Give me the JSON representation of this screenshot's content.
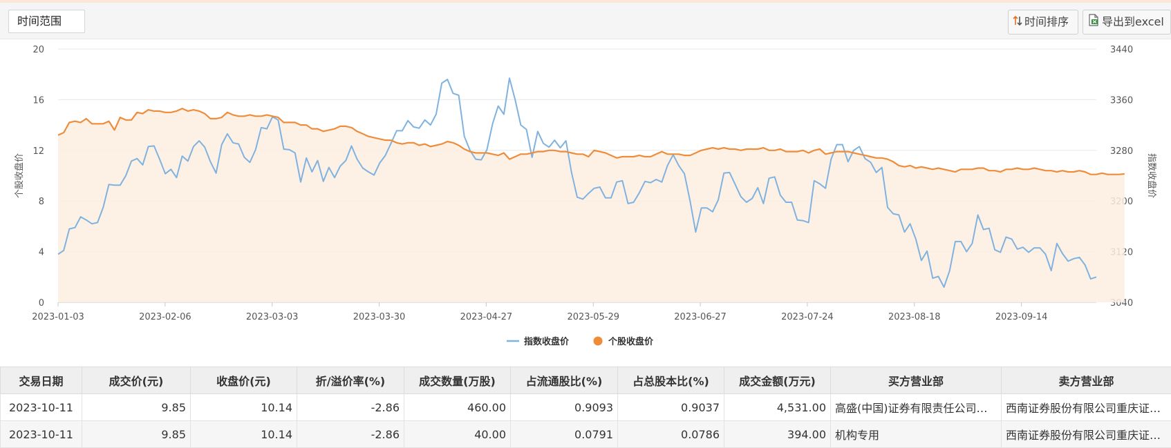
{
  "toolbar": {
    "range_label": "时间范围",
    "sort_label": "时间排序",
    "export_label": "导出到excel"
  },
  "chart_data": {
    "type": "line",
    "xlabel": "",
    "ylabel": "个股收盘价",
    "y2label": "指数收盘价",
    "ylim": [
      0,
      20
    ],
    "y2lim": [
      3040,
      3440
    ],
    "yticks": [
      "0",
      "4",
      "8",
      "12",
      "16",
      "20"
    ],
    "y2ticks": [
      "3040",
      "3120",
      "3200",
      "3280",
      "3360",
      "3440"
    ],
    "xticks": [
      "2023-01-03",
      "2023-02-06",
      "2023-03-03",
      "2023-03-30",
      "2023-04-27",
      "2023-05-29",
      "2023-06-27",
      "2023-07-24",
      "2023-08-18",
      "2023-09-14"
    ],
    "legend_position": "bottom",
    "grid": true,
    "series": [
      {
        "name": "指数收盘价",
        "axis": "right",
        "color": "#7fb2df",
        "values": [
          3116,
          3122,
          3156,
          3158,
          3175,
          3170,
          3164,
          3166,
          3190,
          3226,
          3225,
          3225,
          3240,
          3263,
          3267,
          3257,
          3286,
          3287,
          3266,
          3243,
          3250,
          3237,
          3271,
          3263,
          3286,
          3295,
          3285,
          3262,
          3244,
          3289,
          3306,
          3292,
          3290,
          3269,
          3261,
          3281,
          3316,
          3314,
          3333,
          3328,
          3282,
          3281,
          3276,
          3230,
          3268,
          3246,
          3264,
          3231,
          3253,
          3237,
          3255,
          3264,
          3287,
          3266,
          3252,
          3246,
          3241,
          3260,
          3272,
          3291,
          3311,
          3311,
          3327,
          3317,
          3315,
          3328,
          3320,
          3337,
          3386,
          3392,
          3370,
          3367,
          3302,
          3280,
          3266,
          3265,
          3281,
          3322,
          3350,
          3337,
          3394,
          3360,
          3320,
          3313,
          3269,
          3310,
          3291,
          3285,
          3296,
          3284,
          3295,
          3245,
          3206,
          3203,
          3212,
          3220,
          3222,
          3205,
          3205,
          3230,
          3232,
          3196,
          3198,
          3213,
          3231,
          3229,
          3234,
          3230,
          3256,
          3273,
          3256,
          3243,
          3200,
          3151,
          3189,
          3189,
          3183,
          3202,
          3244,
          3245,
          3226,
          3207,
          3198,
          3204,
          3221,
          3196,
          3236,
          3238,
          3209,
          3198,
          3198,
          3170,
          3169,
          3166,
          3232,
          3227,
          3220,
          3266,
          3289,
          3289,
          3262,
          3280,
          3286,
          3267,
          3261,
          3245,
          3253,
          3190,
          3180,
          3178,
          3151,
          3164,
          3140,
          3106,
          3121,
          3078,
          3081,
          3064,
          3090,
          3136,
          3136,
          3120,
          3133,
          3178,
          3155,
          3157,
          3123,
          3119,
          3143,
          3140,
          3124,
          3127,
          3119,
          3126,
          3126,
          3116,
          3090,
          3133,
          3117,
          3105,
          3109,
          3111,
          3099,
          3077,
          3080
        ]
      },
      {
        "name": "个股收盘价",
        "axis": "left",
        "color": "#ef8c3a",
        "values": [
          13.2,
          13.4,
          14.2,
          14.3,
          14.2,
          14.5,
          14.1,
          14.1,
          14.1,
          14.3,
          13.6,
          14.6,
          14.4,
          14.4,
          15.0,
          14.9,
          15.2,
          15.1,
          15.1,
          15.0,
          15.0,
          15.1,
          15.3,
          15.1,
          15.2,
          15.1,
          14.9,
          14.5,
          14.5,
          14.6,
          15.0,
          14.8,
          14.7,
          14.7,
          14.8,
          14.7,
          14.7,
          14.8,
          14.7,
          14.6,
          14.2,
          14.2,
          14.2,
          14.0,
          14.0,
          13.7,
          13.7,
          13.5,
          13.6,
          13.7,
          13.9,
          13.9,
          13.8,
          13.5,
          13.3,
          13.1,
          13.0,
          12.9,
          12.8,
          12.8,
          12.6,
          12.5,
          12.6,
          12.6,
          12.4,
          12.5,
          12.3,
          12.4,
          12.5,
          12.7,
          12.6,
          12.4,
          12.1,
          11.9,
          11.8,
          11.8,
          11.8,
          11.7,
          11.6,
          11.8,
          11.3,
          11.5,
          11.7,
          11.7,
          11.8,
          11.9,
          11.9,
          12.0,
          12.0,
          11.9,
          11.9,
          11.8,
          11.7,
          11.7,
          11.5,
          12.0,
          11.9,
          11.8,
          11.6,
          11.4,
          11.5,
          11.5,
          11.5,
          11.6,
          11.5,
          11.5,
          11.7,
          11.9,
          11.7,
          11.7,
          11.7,
          11.6,
          11.6,
          11.8,
          12.0,
          12.1,
          12.2,
          12.1,
          12.2,
          12.1,
          12.1,
          12.0,
          12.1,
          12.1,
          12.1,
          12.2,
          12.0,
          12.0,
          12.1,
          11.9,
          11.9,
          11.9,
          12.0,
          11.8,
          12.0,
          12.1,
          11.7,
          11.8,
          11.9,
          11.9,
          11.9,
          11.8,
          11.7,
          11.6,
          11.5,
          11.4,
          11.4,
          11.3,
          11.1,
          10.8,
          10.7,
          10.8,
          10.6,
          10.7,
          10.6,
          10.5,
          10.6,
          10.5,
          10.4,
          10.3,
          10.5,
          10.5,
          10.5,
          10.6,
          10.6,
          10.4,
          10.4,
          10.3,
          10.5,
          10.5,
          10.6,
          10.5,
          10.5,
          10.6,
          10.5,
          10.4,
          10.4,
          10.3,
          10.4,
          10.3,
          10.3,
          10.4,
          10.3,
          10.1,
          10.1,
          10.2,
          10.1,
          10.1,
          10.1,
          10.14
        ]
      }
    ]
  },
  "table": {
    "columns": [
      "交易日期",
      "成交价(元)",
      "收盘价(元)",
      "折/溢价率(%)",
      "成交数量(万股)",
      "占流通股比(%)",
      "占总股本比(%)",
      "成交金额(万元)",
      "买方营业部",
      "卖方营业部"
    ],
    "rows": [
      [
        "2023-10-11",
        "9.85",
        "10.14",
        "-2.86",
        "460.00",
        "0.9093",
        "0.9037",
        "4,531.00",
        "高盛(中国)证券有限责任公司上海浦东新区世纪大道证券营业部",
        "西南证券股份有限公司重庆证券营业部"
      ],
      [
        "2023-10-11",
        "9.85",
        "10.14",
        "-2.86",
        "40.00",
        "0.0791",
        "0.0786",
        "394.00",
        "机构专用",
        "西南证券股份有限公司重庆证券营业部"
      ]
    ]
  }
}
